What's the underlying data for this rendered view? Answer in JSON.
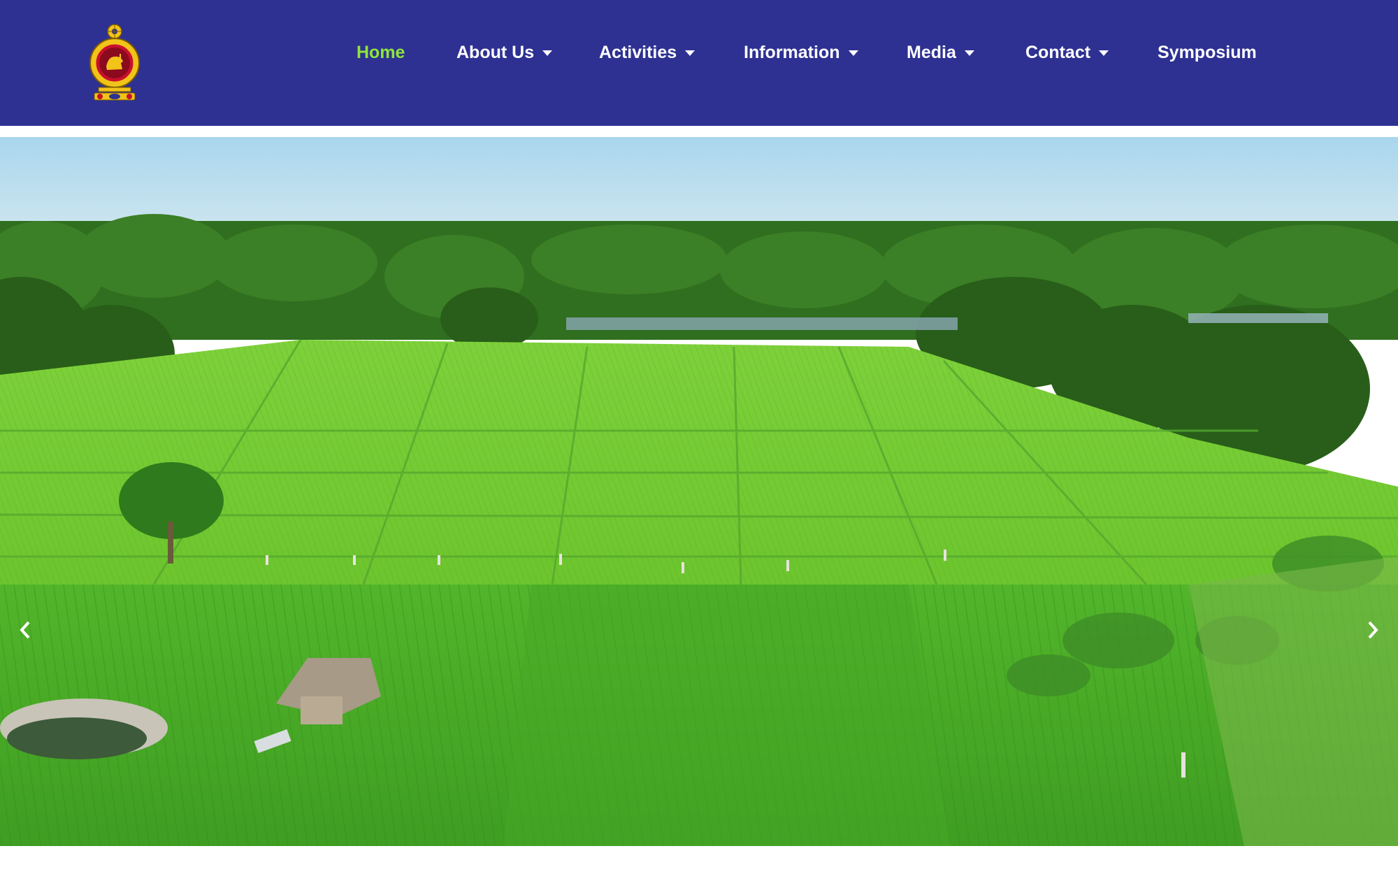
{
  "header": {
    "logo_icon": "national-emblem-icon",
    "colors": {
      "background": "#2e3192",
      "active": "#8ee63a",
      "text": "#ffffff"
    }
  },
  "nav": {
    "items": [
      {
        "label": "Home",
        "active": true,
        "dropdown": false
      },
      {
        "label": "About Us",
        "active": false,
        "dropdown": true
      },
      {
        "label": "Activities",
        "active": false,
        "dropdown": true
      },
      {
        "label": "Information",
        "active": false,
        "dropdown": true
      },
      {
        "label": "Media",
        "active": false,
        "dropdown": true
      },
      {
        "label": "Contact",
        "active": false,
        "dropdown": true
      },
      {
        "label": "Symposium",
        "active": false,
        "dropdown": false
      }
    ]
  },
  "hero": {
    "image_icon": "aerial-farm-fields-image",
    "prev_icon": "chevron-left-icon",
    "next_icon": "chevron-right-icon"
  }
}
